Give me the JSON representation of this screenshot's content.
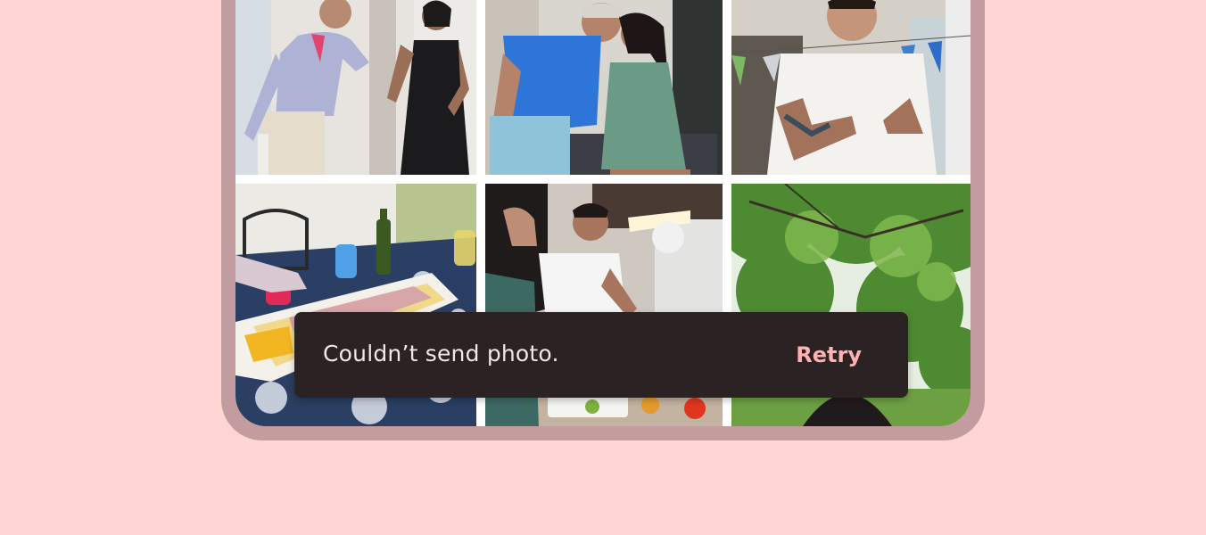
{
  "gallery": {
    "photos": [
      {
        "subject": "elderly man dancing with young woman in black dress"
      },
      {
        "subject": "older woman kissing younger woman on cheek"
      },
      {
        "subject": "laughing man in white shirt with tattoos"
      },
      {
        "subject": "dining table with food platter and bottles"
      },
      {
        "subject": "two people cooking in a kitchen"
      },
      {
        "subject": "green tree canopy outdoors"
      }
    ]
  },
  "snackbar": {
    "message": "Couldn’t send photo.",
    "action_label": "Retry"
  },
  "colors": {
    "background": "#ffd6d4",
    "device_frame": "#c29c9f",
    "snackbar_surface": "#2b2224",
    "snackbar_text": "#f4e6e6",
    "snackbar_action": "#ffb2b1"
  }
}
